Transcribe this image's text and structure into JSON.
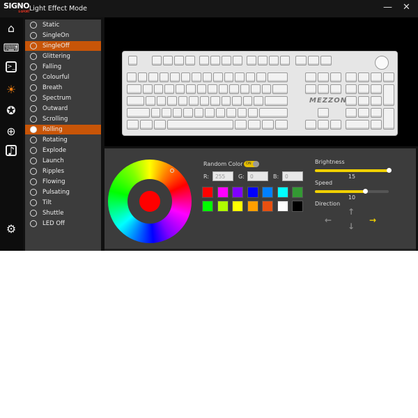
{
  "app": {
    "logo": "SIGNO",
    "logo_sub": "E-SPORT",
    "title": "Light Effect Mode",
    "minimize": "—",
    "close": "✕"
  },
  "sidebar": [
    {
      "icon": "home-icon"
    },
    {
      "icon": "keyboard-icon"
    },
    {
      "icon": "terminal-icon"
    },
    {
      "icon": "lightbulb-icon",
      "active": true
    },
    {
      "icon": "macro-icon"
    },
    {
      "icon": "globe-icon"
    },
    {
      "icon": "music-icon"
    },
    {
      "icon": "gear-icon"
    }
  ],
  "effects": {
    "selected": "Rolling",
    "hovered": "SingleOff",
    "items": [
      "Static",
      "SingleOn",
      "SingleOff",
      "Glittering",
      "Falling",
      "Colourful",
      "Breath",
      "Spectrum",
      "Outward",
      "Scrolling",
      "Rolling",
      "Rotating",
      "Explode",
      "Launch",
      "Ripples",
      "Flowing",
      "Pulsating",
      "Tilt",
      "Shuttle",
      "LED Off"
    ]
  },
  "keyboard": {
    "brand": "MEZZON"
  },
  "color": {
    "random_label": "Random Color",
    "random_state": "ON",
    "r_label": "R:",
    "g_label": "G:",
    "b_label": "B:",
    "r": "255",
    "g": "0",
    "b": "0",
    "current": "#ff0000",
    "swatches": [
      "#ff0000",
      "#ff00ff",
      "#8000ff",
      "#0000ff",
      "#0080ff",
      "#00ffff",
      "#339933",
      "#00ff00",
      "#b0ff00",
      "#ffff00",
      "#ffa000",
      "#e85010",
      "#ffffff",
      "#000000"
    ]
  },
  "brightness": {
    "label": "Brightness",
    "value": "15",
    "max": 15
  },
  "speed": {
    "label": "Speed",
    "value": "10",
    "max": 15,
    "fraction": 0.68
  },
  "direction": {
    "label": "Direction",
    "selected": "right",
    "accent": "#f0d000"
  }
}
